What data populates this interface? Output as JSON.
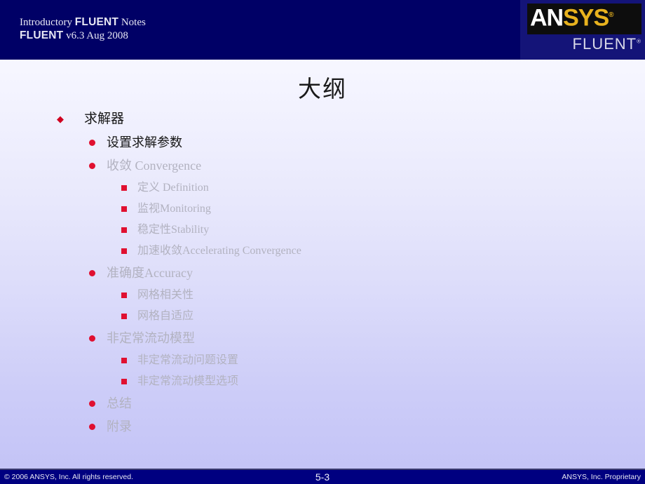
{
  "header": {
    "line1_part1": "Introductory ",
    "line1_part2": "FLUENT",
    "line1_part3": " Notes",
    "line2_part1": "FLUENT",
    "line2_part2": " v6.3  Aug 2008",
    "background_color": "#000066"
  },
  "logo": {
    "ansys_prefix": "AN",
    "ansys_suffix": "SYS",
    "registered_mark": "®",
    "fluent": "FLUENT",
    "fluent_registered_mark": "®",
    "gold_color": "#e8b21e"
  },
  "title": {
    "text": "大纲"
  },
  "outline": [
    {
      "level": 1,
      "bullet": "diamond-bullet",
      "text": "求解器",
      "color": "dark"
    },
    {
      "level": 2,
      "bullet": "round-bullet",
      "text": "设置求解参数",
      "color": "dark"
    },
    {
      "level": 2,
      "bullet": "round-bullet",
      "text": "收敛 Convergence",
      "color": "gray"
    },
    {
      "level": 3,
      "bullet": "square-bullet",
      "text": "定义 Definition",
      "color": "gray"
    },
    {
      "level": 3,
      "bullet": "square-bullet",
      "text": "监视Monitoring",
      "color": "gray"
    },
    {
      "level": 3,
      "bullet": "square-bullet",
      "text": "稳定性Stability",
      "color": "gray"
    },
    {
      "level": 3,
      "bullet": "square-bullet",
      "text": "加速收敛Accelerating Convergence",
      "color": "gray"
    },
    {
      "level": 2,
      "bullet": "round-bullet",
      "text": "准确度Accuracy",
      "color": "gray"
    },
    {
      "level": 3,
      "bullet": "square-bullet",
      "text": "网格相关性",
      "color": "gray"
    },
    {
      "level": 3,
      "bullet": "square-bullet",
      "text": "网格自适应",
      "color": "gray"
    },
    {
      "level": 2,
      "bullet": "round-bullet",
      "text": "非定常流动模型",
      "color": "gray"
    },
    {
      "level": 3,
      "bullet": "square-bullet",
      "text": "非定常流动问题设置",
      "color": "gray"
    },
    {
      "level": 3,
      "bullet": "square-bullet",
      "text": "非定常流动模型选项",
      "color": "gray"
    },
    {
      "level": 2,
      "bullet": "round-bullet",
      "text": "总结",
      "color": "gray"
    },
    {
      "level": 2,
      "bullet": "round-bullet",
      "text": "附录",
      "color": "gray"
    }
  ],
  "footer": {
    "copyright": "© 2006 ANSYS, Inc.  All rights reserved.",
    "page_number": "5-3",
    "proprietary": "ANSYS, Inc. Proprietary",
    "background_color": "#000080"
  }
}
